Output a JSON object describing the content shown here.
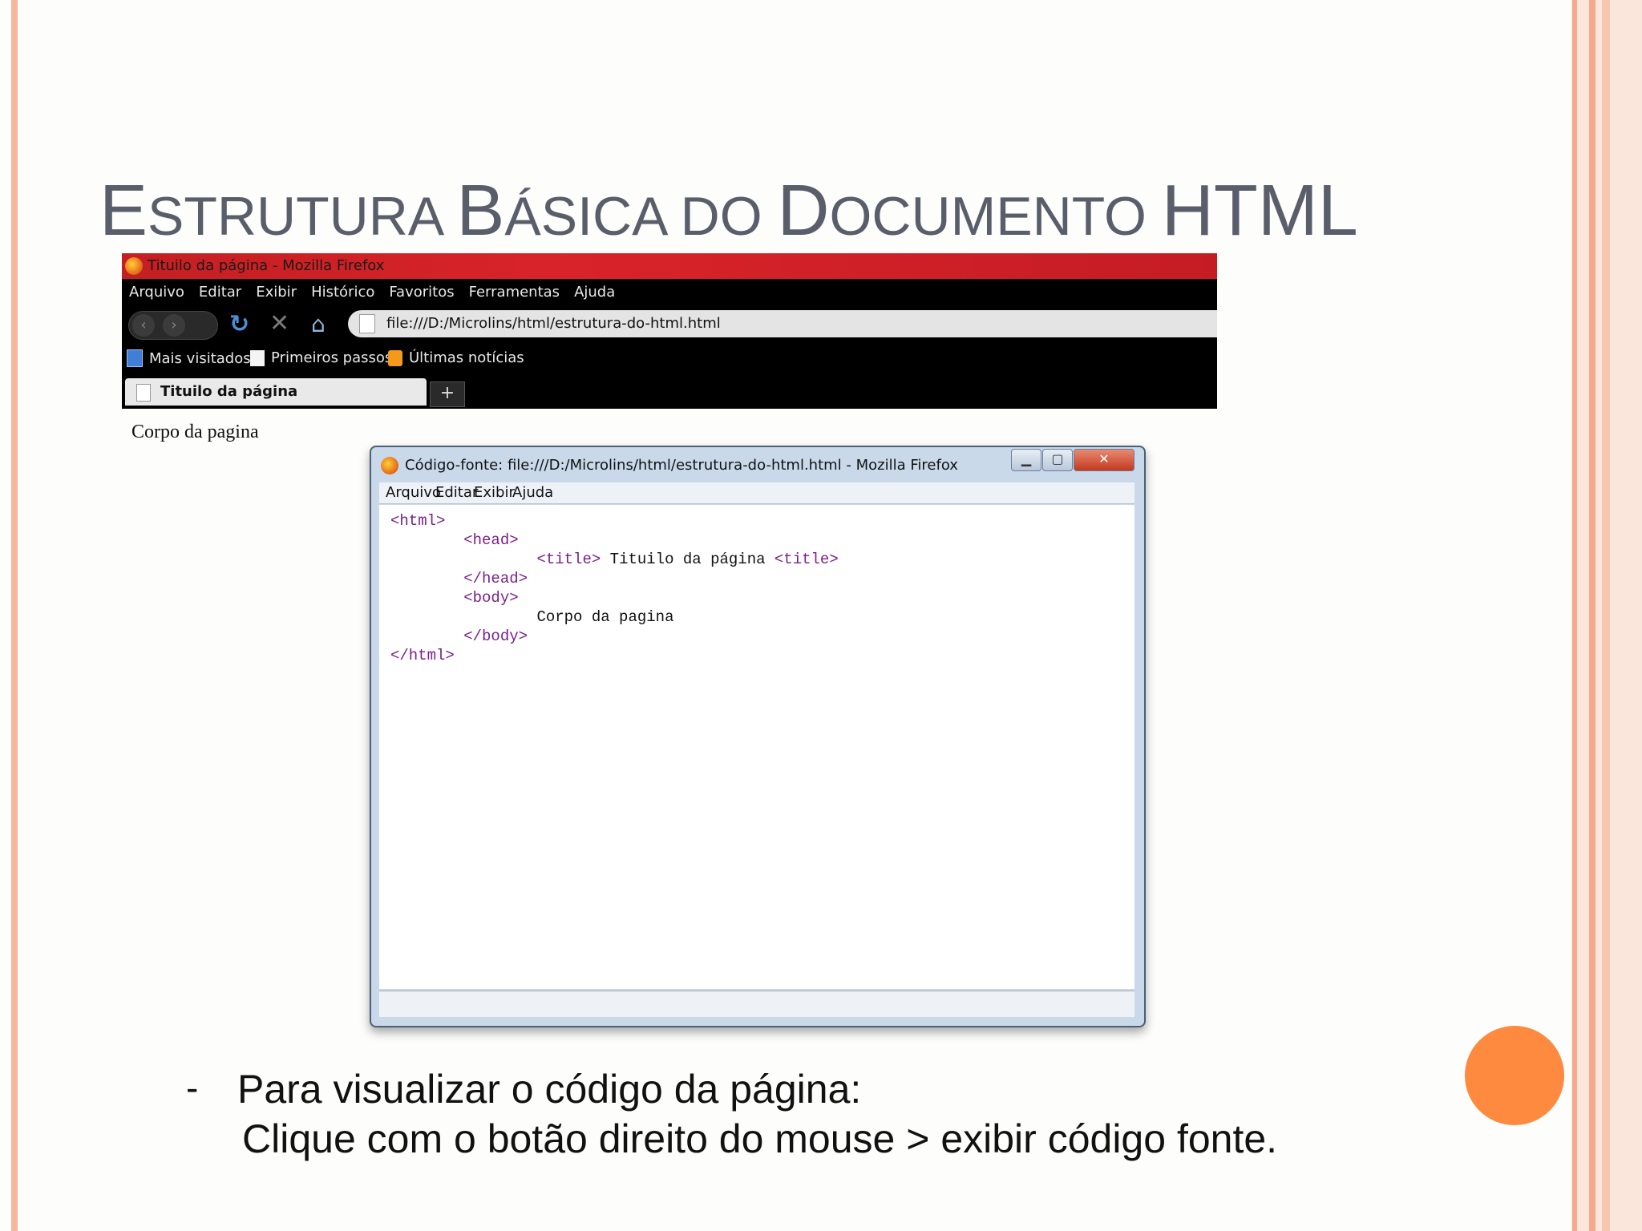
{
  "slide": {
    "title_parts": [
      {
        "text": "E",
        "size": "big"
      },
      {
        "text": "STRUTURA ",
        "size": "small"
      },
      {
        "text": "B",
        "size": "big"
      },
      {
        "text": "ÁSICA DO ",
        "size": "small"
      },
      {
        "text": "D",
        "size": "big"
      },
      {
        "text": "OCUMENTO ",
        "size": "small"
      },
      {
        "text": "HTML",
        "size": "big"
      }
    ],
    "bullet_dash": "-",
    "bullet_line1": "Para visualizar o código da página:",
    "bullet_line2": "Clique com o botão direito do mouse > exibir código fonte.",
    "accent_color": "#fd8a3e"
  },
  "firefox": {
    "window_title": "Tituilo da página - Mozilla Firefox",
    "menu": [
      "Arquivo",
      "Editar",
      "Exibir",
      "Histórico",
      "Favoritos",
      "Ferramentas",
      "Ajuda"
    ],
    "address": "file:///D:/Microlins/html/estrutura-do-html.html",
    "bookmarks": [
      {
        "label": "Mais visitados",
        "icon": "most-visited-icon"
      },
      {
        "label": "Primeiros passos",
        "icon": "page-icon"
      },
      {
        "label": "Últimas notícias",
        "icon": "rss-icon"
      }
    ],
    "tab_label": "Tituilo da página",
    "new_tab": "+",
    "page_body_text": "Corpo da pagina"
  },
  "source_window": {
    "title": "Código-fonte: file:///D:/Microlins/html/estrutura-do-html.html - Mozilla Firefox",
    "menu": [
      "Arquivo",
      "Editar",
      "Exibir",
      "Ajuda"
    ],
    "code_lines": [
      {
        "indent": 0,
        "parts": [
          {
            "t": "<html>",
            "tag": true
          }
        ]
      },
      {
        "indent": 1,
        "parts": [
          {
            "t": "<head>",
            "tag": true
          }
        ]
      },
      {
        "indent": 2,
        "parts": [
          {
            "t": "<title>",
            "tag": true
          },
          {
            "t": " Tituilo da página ",
            "tag": false
          },
          {
            "t": "<title>",
            "tag": true
          }
        ]
      },
      {
        "indent": 1,
        "parts": [
          {
            "t": "</head>",
            "tag": true
          }
        ]
      },
      {
        "indent": 1,
        "parts": [
          {
            "t": "<body>",
            "tag": true
          }
        ]
      },
      {
        "indent": 2,
        "parts": [
          {
            "t": "Corpo da pagina",
            "tag": false
          }
        ]
      },
      {
        "indent": 1,
        "parts": [
          {
            "t": "</body>",
            "tag": true
          }
        ]
      },
      {
        "indent": 0,
        "parts": [
          {
            "t": "</html>",
            "tag": true
          }
        ]
      }
    ]
  }
}
